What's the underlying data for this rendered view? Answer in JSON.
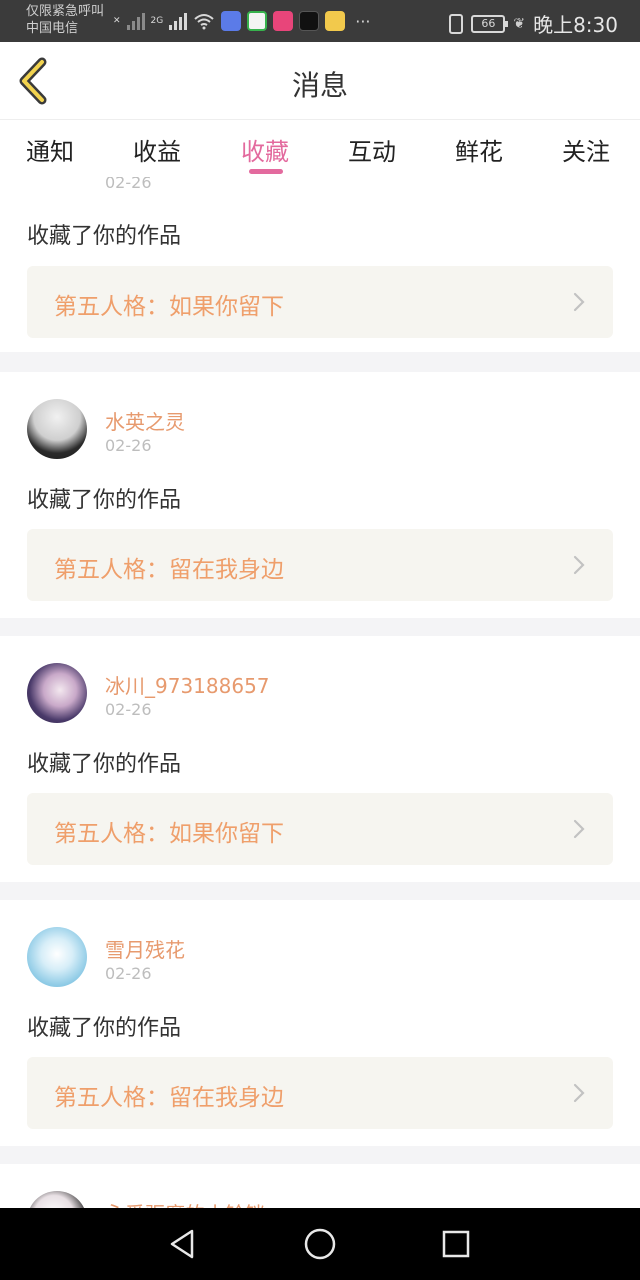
{
  "status_bar": {
    "carrier_line1": "仅限紧急呼叫",
    "carrier_line2": "中国电信",
    "network_2g": "2G",
    "battery": "66",
    "time": "晚上8:30"
  },
  "header": {
    "title": "消息",
    "back_icon": "chevron-left-icon"
  },
  "tabs": [
    {
      "label": "通知",
      "active": false
    },
    {
      "label": "收益",
      "active": false
    },
    {
      "label": "收藏",
      "active": true
    },
    {
      "label": "互动",
      "active": false
    },
    {
      "label": "鲜花",
      "active": false
    },
    {
      "label": "关注",
      "active": false
    }
  ],
  "messages": [
    {
      "username": "",
      "date": "02-26",
      "action": "收藏了你的作品",
      "work_title": "第五人格：如果你留下"
    },
    {
      "username": "水英之灵",
      "date": "02-26",
      "action": "收藏了你的作品",
      "work_title": "第五人格：留在我身边"
    },
    {
      "username": "冰川_973188657",
      "date": "02-26",
      "action": "收藏了你的作品",
      "work_title": "第五人格：如果你留下"
    },
    {
      "username": "雪月残花",
      "date": "02-26",
      "action": "收藏了你的作品",
      "work_title": "第五人格：留在我身边"
    },
    {
      "username": "永爱驱魔的小铃铛",
      "date": "",
      "action": "",
      "work_title": ""
    }
  ],
  "colors": {
    "accent_pink": "#e36a9e",
    "username_orange": "#e79a6e",
    "work_title_orange": "#ef9f6b",
    "work_bg": "#f6f5f0"
  }
}
